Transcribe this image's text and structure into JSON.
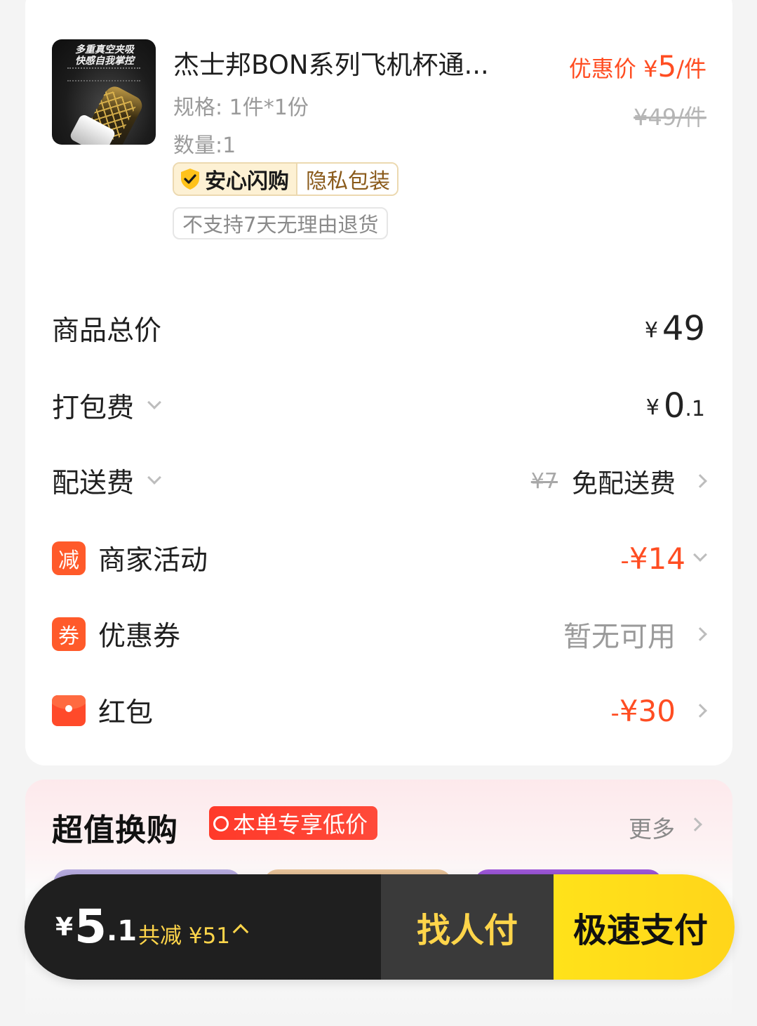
{
  "product": {
    "image_text_line1": "多重真空夹吸",
    "image_text_line2": "快感自我掌控",
    "title": "杰士邦BON系列飞机杯通...",
    "spec": "规格: 1件*1份",
    "quantity": "数量:1",
    "promo_label": "优惠价",
    "promo_yen": "¥",
    "promo_price": "5",
    "promo_unit": "/件",
    "original_price": "¥49/件",
    "badge_safe": "安心闪购",
    "badge_private": "隐私包装",
    "no_return_tag": "不支持7天无理由退货"
  },
  "summary": {
    "total": {
      "label": "商品总价",
      "yen": "¥",
      "value": "49"
    },
    "packing": {
      "label": "打包费",
      "yen": "¥",
      "int": "0",
      "dec": ".1"
    },
    "delivery": {
      "label": "配送费",
      "original": "¥7",
      "value": "免配送费"
    },
    "merchant": {
      "icon_text": "减",
      "label": "商家活动",
      "sign": "-",
      "value": "¥14"
    },
    "coupon": {
      "icon_text": "券",
      "label": "优惠券",
      "value": "暂无可用"
    },
    "redpacket": {
      "label": "红包",
      "sign": "-",
      "value": "¥30"
    }
  },
  "deals": {
    "title": "超值换购",
    "tag": "本单专享低价",
    "more": "更多"
  },
  "paybar": {
    "yen": "¥",
    "amount_int": "5",
    "amount_dec": ".1",
    "saved": "共减 ¥51",
    "find_pay": "找人付",
    "fast_pay": "极速支付"
  },
  "colors": {
    "accent_red": "#ff4d22",
    "pay_yellow": "#ffd51a",
    "pay_dark": "#1f1f1f"
  }
}
